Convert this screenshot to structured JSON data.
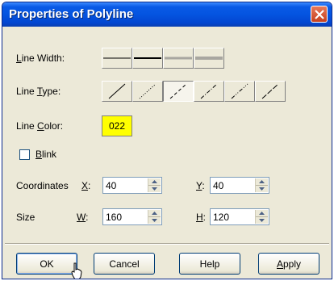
{
  "window": {
    "title": "Properties of Polyline"
  },
  "line_width": {
    "label": "Line Width:",
    "options": [
      "thin",
      "medium",
      "thick-light",
      "thickest-light"
    ]
  },
  "line_type": {
    "label": "Line Type:",
    "selected_index": 2,
    "options": [
      "solid",
      "dotted",
      "dashed",
      "dash-dot",
      "dash-dot-dot",
      "long-dash"
    ]
  },
  "line_color": {
    "label": "Line Color:",
    "value": "022",
    "color": "#ffff00"
  },
  "blink": {
    "label": "Blink",
    "checked": false
  },
  "coordinates": {
    "label": "Coordinates",
    "x_label": "X:",
    "x_value": "40",
    "y_label": "Y:",
    "y_value": "40"
  },
  "size": {
    "label": "Size",
    "w_label": "W:",
    "w_value": "160",
    "h_label": "H:",
    "h_value": "120"
  },
  "buttons": {
    "ok": "OK",
    "cancel": "Cancel",
    "help": "Help",
    "apply": "Apply"
  }
}
